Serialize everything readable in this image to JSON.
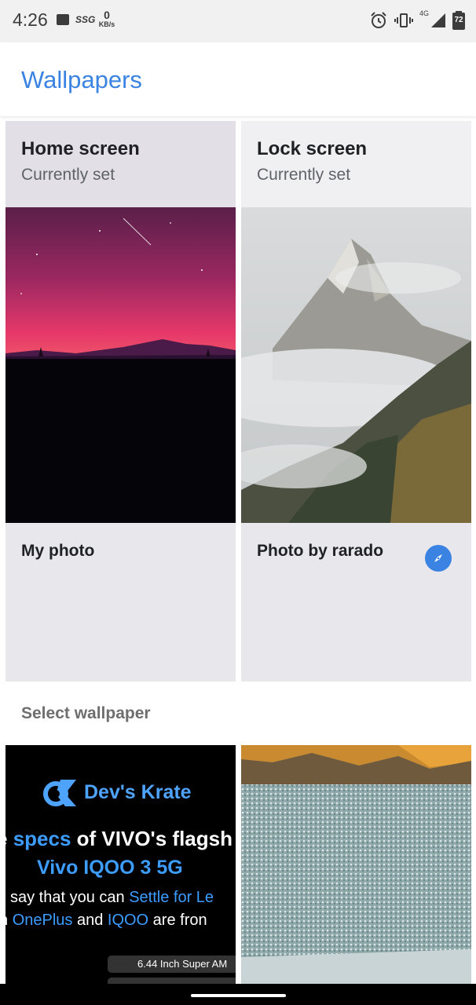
{
  "status_bar": {
    "time": "4:26",
    "carrier_badge": "SSG",
    "net_speed_value": "0",
    "net_speed_unit": "KB/s",
    "network_type": "4G",
    "battery": "72",
    "icons": [
      "image-icon",
      "alarm-icon",
      "vibrate-icon",
      "signal-icon",
      "battery-icon"
    ]
  },
  "app_bar": {
    "title": "Wallpapers"
  },
  "current": {
    "home": {
      "title": "Home screen",
      "subtitle": "Currently set",
      "footer": "My photo"
    },
    "lock": {
      "title": "Lock screen",
      "subtitle": "Currently set",
      "footer": "Photo by rarado",
      "action_icon": "explore-icon"
    }
  },
  "select": {
    "title": "Select wallpaper",
    "thumbnails": [
      {
        "brand": "Dev's Krate",
        "line1_pre": "e ",
        "line1_hl": "specs",
        "line1_post": " of VIVO's flagsh",
        "line2": "Vivo IQOO 3 5G",
        "line3_pre": "say that you can ",
        "line3_hl": "Settle for Le",
        "line4_pre": "n ",
        "line4_hl1": "OnePlus",
        "line4_mid": " and ",
        "line4_hl2": "IQOO",
        "line4_post": " are fron",
        "spec_label": "6.44 Inch Super AM"
      },
      {
        "name": "textured-landscape"
      }
    ]
  },
  "colors": {
    "accent": "#3b83e2",
    "card_bg": "#e8e8ec",
    "status_bg": "#f1f1f1"
  }
}
